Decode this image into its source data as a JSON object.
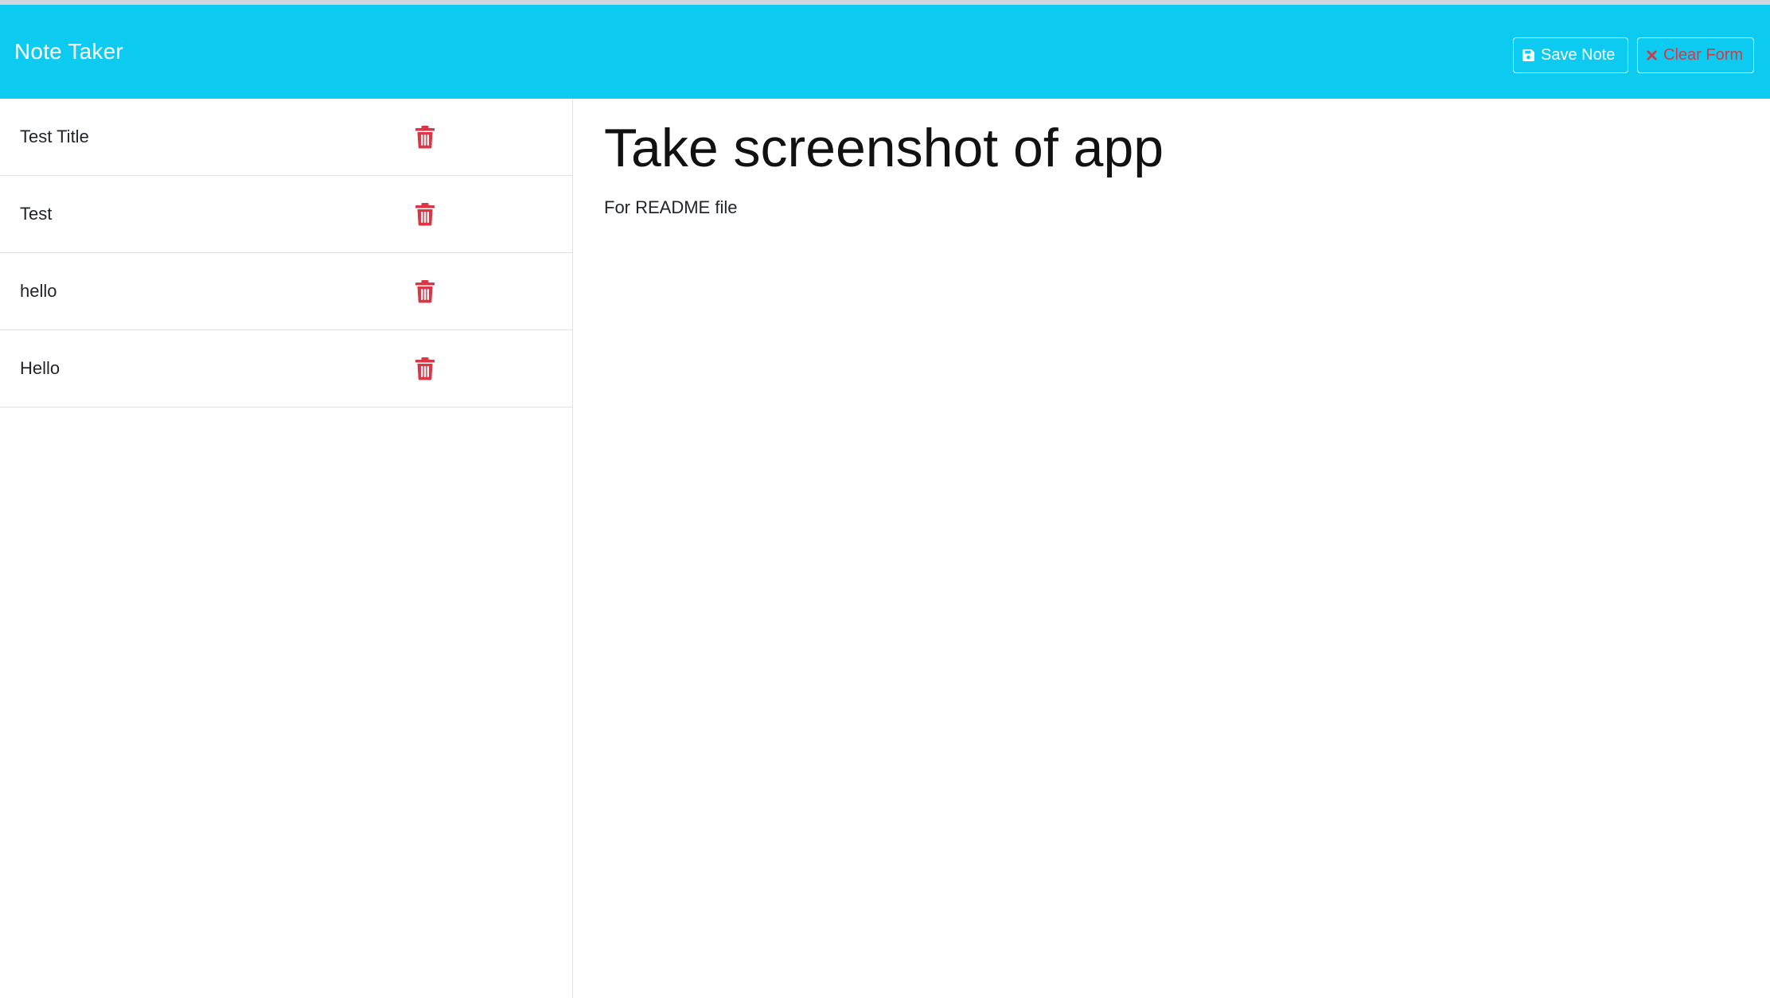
{
  "app": {
    "title": "Note Taker"
  },
  "toolbar": {
    "save_label": "Save Note",
    "save_icon": "floppy-disk-icon",
    "clear_label": "Clear Form",
    "clear_icon": "close-x-icon"
  },
  "notes": [
    {
      "title": "Test Title",
      "delete_icon": "trash-icon"
    },
    {
      "title": "Test",
      "delete_icon": "trash-icon"
    },
    {
      "title": "hello",
      "delete_icon": "trash-icon"
    },
    {
      "title": "Hello",
      "delete_icon": "trash-icon"
    }
  ],
  "active_note": {
    "title": "Take screenshot of app",
    "text": "For README file"
  },
  "colors": {
    "navbar": "#0dcaf0",
    "danger": "#dc3545",
    "border": "#dfe2e6"
  }
}
